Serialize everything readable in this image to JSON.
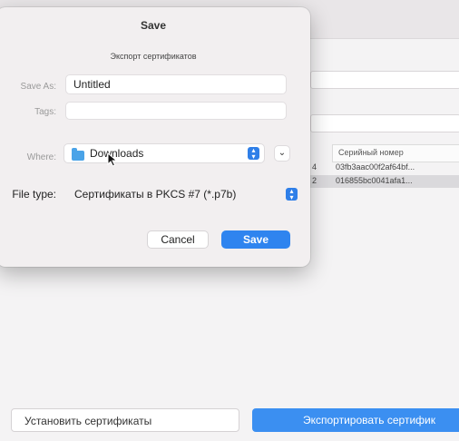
{
  "background": {
    "table": {
      "column_header": "Серийный номер",
      "rows": [
        {
          "index": "4",
          "serial": "03fb3aac00f2af64bf..."
        },
        {
          "index": "2",
          "serial": "016855bc0041afa1..."
        }
      ]
    },
    "bottom_buttons": {
      "install": "Установить сертификаты",
      "export": "Экспортировать сертифик"
    }
  },
  "dialog": {
    "title": "Save",
    "subtitle": "Экспорт сертификатов",
    "save_as": {
      "label": "Save As:",
      "value": "Untitled"
    },
    "tags": {
      "label": "Tags:",
      "value": ""
    },
    "where": {
      "label": "Where:",
      "value": "Downloads",
      "icon": "folder-icon"
    },
    "file_type": {
      "label": "File type:",
      "value": "Сертификаты в PKCS #7 (*.p7b)"
    },
    "cancel_label": "Cancel",
    "save_label": "Save"
  },
  "colors": {
    "accent": "#2f84ef",
    "dialog_bg": "#f2eff0",
    "window_bg": "#f4f3f4"
  }
}
